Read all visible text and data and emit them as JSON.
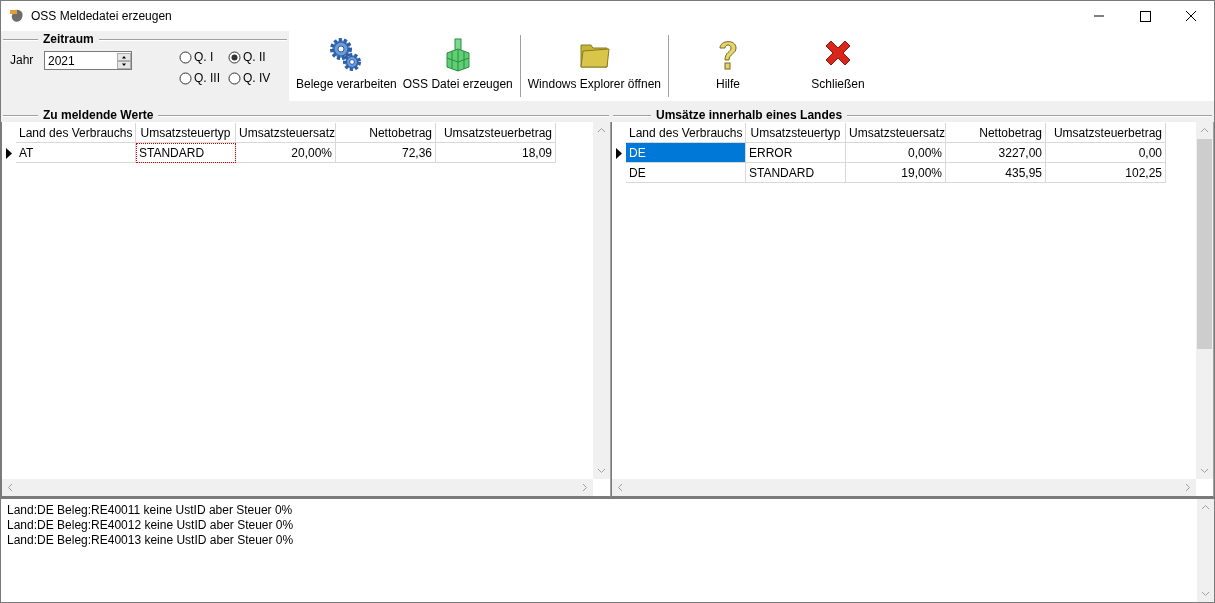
{
  "window": {
    "title": "OSS Meldedatei erzeugen"
  },
  "period": {
    "title": "Zeitraum",
    "year_label": "Jahr",
    "year": "2021",
    "quarters": [
      {
        "label": "Q. I",
        "selected": false
      },
      {
        "label": "Q. II",
        "selected": true
      },
      {
        "label": "Q. III",
        "selected": false
      },
      {
        "label": "Q. IV",
        "selected": false
      }
    ]
  },
  "toolbar": [
    [
      {
        "label": "Belege verarbeiten"
      },
      {
        "label": "OSS Datei erzeugen"
      }
    ],
    [
      {
        "label": "Windows Explorer öffnen"
      }
    ],
    [
      {
        "label": "Hilfe"
      },
      {
        "label": "Schließen"
      }
    ]
  ],
  "grids": [
    {
      "title": "Zu meldende Werte",
      "columns": [
        {
          "label": "Land des Verbrauchs",
          "kind": "text"
        },
        {
          "label": "Umsatzsteuertyp",
          "kind": "text"
        },
        {
          "label": "Umsatzsteuersatz",
          "kind": "number"
        },
        {
          "label": "Nettobetrag",
          "kind": "number"
        },
        {
          "label": "Umsatzsteuerbetrag",
          "kind": "number"
        }
      ],
      "rows": [
        {
          "current": true,
          "cells": [
            {
              "text": "AT",
              "selected": false,
              "focused": false
            },
            {
              "text": "STANDARD",
              "selected": false,
              "focused": true
            },
            {
              "text": "20,00%",
              "selected": false,
              "focused": false
            },
            {
              "text": "72,36",
              "selected": false,
              "focused": false
            },
            {
              "text": "18,09",
              "selected": false,
              "focused": false
            }
          ]
        }
      ]
    },
    {
      "title": "Umsätze innerhalb eines Landes",
      "columns": [
        {
          "label": "Land des Verbrauchs",
          "kind": "text"
        },
        {
          "label": "Umsatzsteuertyp",
          "kind": "text"
        },
        {
          "label": "Umsatzsteuersatz",
          "kind": "number"
        },
        {
          "label": "Nettobetrag",
          "kind": "number"
        },
        {
          "label": "Umsatzsteuerbetrag",
          "kind": "number"
        }
      ],
      "rows": [
        {
          "current": true,
          "cells": [
            {
              "text": "DE",
              "selected": true,
              "focused": false
            },
            {
              "text": "ERROR",
              "selected": false,
              "focused": false
            },
            {
              "text": "0,00%",
              "selected": false,
              "focused": false
            },
            {
              "text": "3227,00",
              "selected": false,
              "focused": false
            },
            {
              "text": "0,00",
              "selected": false,
              "focused": false
            }
          ]
        },
        {
          "current": false,
          "cells": [
            {
              "text": "DE",
              "selected": false,
              "focused": false
            },
            {
              "text": "STANDARD",
              "selected": false,
              "focused": false
            },
            {
              "text": "19,00%",
              "selected": false,
              "focused": false
            },
            {
              "text": "435,95",
              "selected": false,
              "focused": false
            },
            {
              "text": "102,25",
              "selected": false,
              "focused": false
            }
          ]
        }
      ]
    }
  ],
  "log": [
    "Land:DE Beleg:RE40011 keine UstID aber Steuer 0%",
    "Land:DE Beleg:RE40012 keine UstID aber Steuer 0%",
    "Land:DE Beleg:RE40013 keine UstID aber Steuer 0%"
  ]
}
